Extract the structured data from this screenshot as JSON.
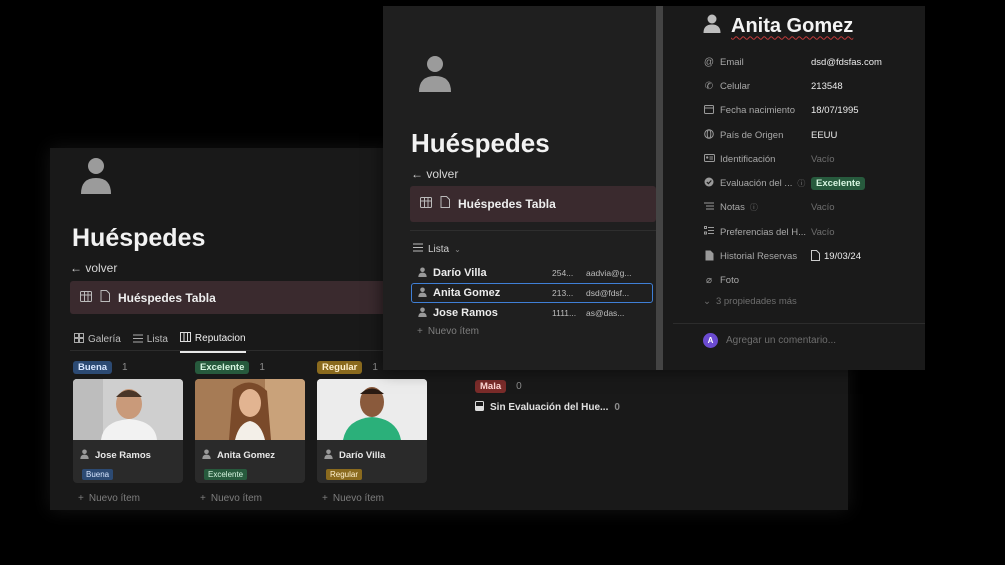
{
  "back_panel": {
    "title": "Huéspedes",
    "back_link": "← volver",
    "linked_db": "Huéspedes Tabla",
    "views": [
      "Galería",
      "Lista",
      "Reputacion"
    ],
    "groups": [
      {
        "label": "Buena",
        "count": "1",
        "card_name": "Jose Ramos",
        "card_tag": "Buena",
        "new_item": "Nuevo ítem"
      },
      {
        "label": "Excelente",
        "count": "1",
        "card_name": "Anita Gomez",
        "card_tag": "Excelente",
        "new_item": "Nuevo ítem"
      },
      {
        "label": "Regular",
        "count": "1",
        "card_name": "Darío Villa",
        "card_tag": "Regular",
        "new_item": "Nuevo ítem"
      }
    ],
    "mala": {
      "label": "Mala",
      "count": "0"
    },
    "sin_evaluacion": {
      "label": "Sin Evaluación del Hue...",
      "count": "0"
    }
  },
  "front_panel": {
    "title": "Huéspedes",
    "back_link": "← volver",
    "linked_db": "Huéspedes Tabla",
    "view_label": "Lista",
    "rows": [
      {
        "name": "Darío Villa",
        "c1": "254...",
        "c2": "aadvia@g..."
      },
      {
        "name": "Anita Gomez",
        "c1": "213...",
        "c2": "dsd@fdsf..."
      },
      {
        "name": "Jose Ramos",
        "c1": "1111...",
        "c2": "as@das..."
      }
    ],
    "new_item": "Nuevo ítem"
  },
  "detail": {
    "name": "Anita Gomez",
    "properties": [
      {
        "key": "Email",
        "value": "dsd@fdsfas.com",
        "icon": "at-icon"
      },
      {
        "key": "Celular",
        "value": "213548",
        "icon": "phone-icon"
      },
      {
        "key": "Fecha nacimiento",
        "value": "18/07/1995",
        "icon": "calendar-icon"
      },
      {
        "key": "País de Origen",
        "value": "EEUU",
        "icon": "globe-icon"
      },
      {
        "key": "Identificación",
        "value": "Vacío",
        "icon": "id-card-icon"
      },
      {
        "key": "Evaluación del ...",
        "value": "Excelente",
        "icon": "check-circle-icon"
      },
      {
        "key": "Notas",
        "value": "Vacío",
        "icon": "list-icon"
      },
      {
        "key": "Preferencias del H...",
        "value": "Vacío",
        "icon": "checklist-icon"
      },
      {
        "key": "Historial Reservas",
        "value": "19/03/24",
        "icon": "document-icon"
      },
      {
        "key": "Foto",
        "value": "",
        "icon": "paperclip-icon"
      }
    ],
    "more_props": "3 propiedades más",
    "comment_avatar": "A",
    "comment_placeholder": "Agregar un comentario..."
  },
  "colors": {
    "buena": "#2c4a73",
    "excelente": "#275a3d",
    "regular": "#8a6a1e",
    "mala": "#7a2c2a",
    "selection": "#3f7fd6",
    "linkbar": "#3a2a2e"
  }
}
